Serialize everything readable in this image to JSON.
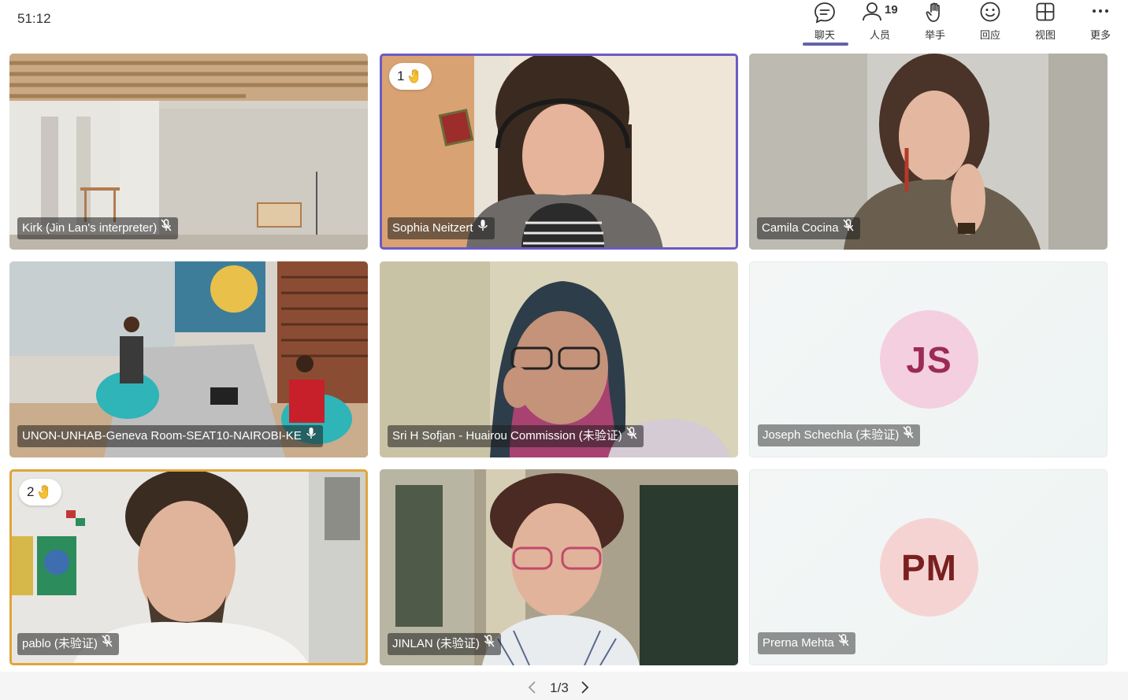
{
  "timer": "51:12",
  "toolbar": {
    "chat": {
      "label": "聊天",
      "icon": "chat-icon"
    },
    "people": {
      "label": "人员",
      "count": "19",
      "icon": "people-icon"
    },
    "raise_hand": {
      "label": "举手",
      "icon": "raise-hand-icon"
    },
    "react": {
      "label": "回应",
      "icon": "smiley-icon"
    },
    "view": {
      "label": "视图",
      "icon": "grid-view-icon"
    },
    "more": {
      "label": "更多",
      "icon": "more-icon"
    },
    "accent": "#6264a7"
  },
  "participants": [
    {
      "name": "Kirk (Jin Lan's interpreter)",
      "muted": true,
      "video": true
    },
    {
      "name": "Sophia Neitzert",
      "muted": false,
      "video": true,
      "hand_raised": "1",
      "speaking": true
    },
    {
      "name": "Camila Cocina",
      "muted": true,
      "video": true
    },
    {
      "name": "UNON-UNHAB-Geneva Room-SEAT10-NAIROBI-KE",
      "muted": false,
      "video": true
    },
    {
      "name": "Sri H Sofjan - Huairou Commission (未验证)",
      "muted": true,
      "video": true
    },
    {
      "name": "Joseph Schechla (未验证)",
      "muted": true,
      "video": false,
      "initials": "JS",
      "avatar_bg": "#f4cfe0",
      "avatar_fg": "#9b2b55"
    },
    {
      "name": "pablo (未验证)",
      "muted": true,
      "video": true,
      "hand_raised": "2"
    },
    {
      "name": "JINLAN (未验证)",
      "muted": true,
      "video": true
    },
    {
      "name": "Prerna Mehta",
      "muted": true,
      "video": false,
      "initials": "PM",
      "avatar_bg": "#f6d3d3",
      "avatar_fg": "#7a1f1f"
    }
  ],
  "pager": {
    "text": "1/3"
  }
}
